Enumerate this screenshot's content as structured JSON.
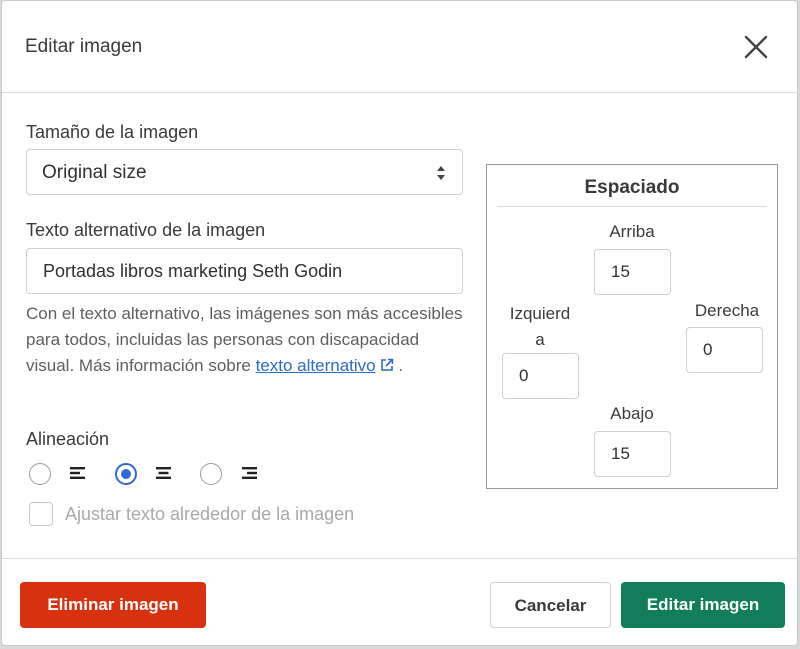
{
  "dialog": {
    "title": "Editar imagen"
  },
  "image_size": {
    "label": "Tamaño de la imagen",
    "selected": "Original size"
  },
  "alt_text": {
    "label": "Texto alternativo de la imagen",
    "value": "Portadas libros marketing Seth Godin",
    "help_text": "Con el texto alternativo, las imágenes son más accesibles para todos, incluidas las personas con discapacidad visual. Más información sobre ",
    "help_link": "texto alternativo",
    "help_end": " ."
  },
  "alignment": {
    "label": "Alineación",
    "options": [
      "left",
      "center",
      "right"
    ],
    "selected": "center"
  },
  "wrap_text": {
    "label": "Ajustar texto alrededor de la imagen",
    "checked": false
  },
  "spacing": {
    "title": "Espaciado",
    "top_label": "Arriba",
    "top_value": "15",
    "left_label_1": "Izquierd",
    "left_label_2": "a",
    "left_value": "0",
    "right_label": "Derecha",
    "right_value": "0",
    "bottom_label": "Abajo",
    "bottom_value": "15"
  },
  "footer": {
    "delete_label": "Eliminar imagen",
    "cancel_label": "Cancelar",
    "edit_label": "Editar imagen"
  },
  "colors": {
    "delete": "#d8310f",
    "edit": "#127d5a",
    "accent": "#2e6ad0",
    "link": "#2b6cc4"
  }
}
